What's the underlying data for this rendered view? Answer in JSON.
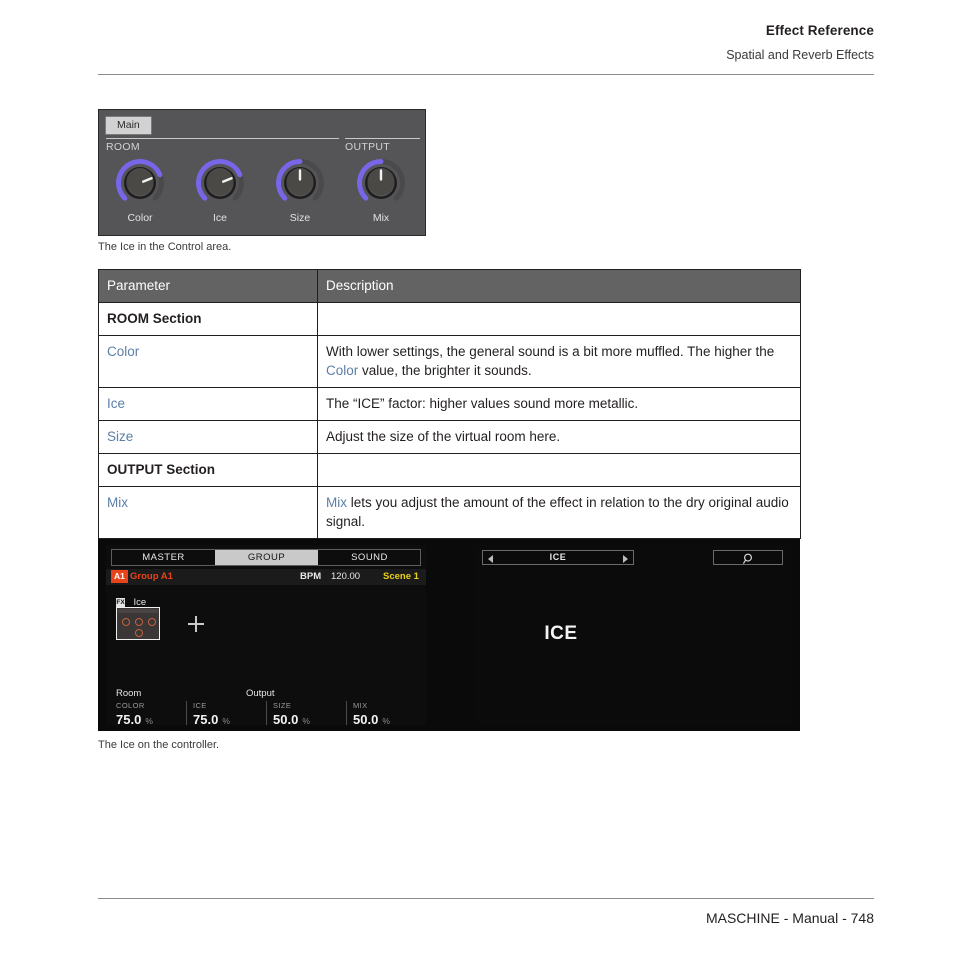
{
  "header": {
    "title": "Effect Reference",
    "subtitle": "Spatial and Reverb Effects"
  },
  "plugin_panel": {
    "tab_label": "Main",
    "sections": {
      "room_label": "ROOM",
      "output_label": "OUTPUT"
    },
    "knobs": [
      {
        "label": "Color",
        "value_pct": 75,
        "arc_color": "#7866e8"
      },
      {
        "label": "Ice",
        "value_pct": 75,
        "arc_color": "#7866e8"
      },
      {
        "label": "Size",
        "value_pct": 50,
        "arc_color": "#7866e8"
      },
      {
        "label": "Mix",
        "value_pct": 50,
        "arc_color": "#7866e8"
      }
    ]
  },
  "caption_control_area": "The Ice in the Control area.",
  "caption_controller": "The Ice on the controller.",
  "table": {
    "headers": [
      "Parameter",
      "Description"
    ],
    "rows": [
      {
        "kind": "section",
        "parameter": "ROOM Section",
        "description": ""
      },
      {
        "kind": "param",
        "parameter": "Color",
        "desc_pre": "With lower settings, the general sound is a bit more muffled. The higher the ",
        "desc_link": "Color",
        "desc_post": " value, the brighter it sounds."
      },
      {
        "kind": "param",
        "parameter": "Ice",
        "desc_pre": "The “ICE” factor: higher values sound more metallic.",
        "desc_link": "",
        "desc_post": ""
      },
      {
        "kind": "param",
        "parameter": "Size",
        "desc_pre": "Adjust the size of the virtual room here.",
        "desc_link": "",
        "desc_post": ""
      },
      {
        "kind": "section",
        "parameter": "OUTPUT Section",
        "description": ""
      },
      {
        "kind": "param-linkfirst",
        "parameter": "Mix",
        "desc_pre": "",
        "desc_link": "Mix",
        "desc_post": " lets you adjust the amount of the effect in relation to the dry original audio signal."
      }
    ]
  },
  "controller": {
    "left_display": {
      "tabs": [
        {
          "label": "MASTER",
          "active": false
        },
        {
          "label": "GROUP",
          "active": true
        },
        {
          "label": "SOUND",
          "active": false
        }
      ],
      "group_badge": "A1",
      "group_name": "Group A1",
      "bpm_label": "BPM",
      "bpm_value": "120.00",
      "scene": "Scene 1",
      "fx_icon_text": "FX",
      "fx_name": "Ice",
      "add_slot_label": "+",
      "section_room": "Room",
      "section_output": "Output",
      "parameters": [
        {
          "name": "COLOR",
          "value": "75.0",
          "unit": "%"
        },
        {
          "name": "ICE",
          "value": "75.0",
          "unit": "%"
        },
        {
          "name": "SIZE",
          "value": "50.0",
          "unit": "%"
        },
        {
          "name": "MIX",
          "value": "50.0",
          "unit": "%"
        }
      ]
    },
    "right_display": {
      "selector_value": "ICE",
      "search_icon": "magnifier-icon",
      "plugin_name": "ICE"
    }
  },
  "footer": {
    "text": "MASCHINE - Manual - 748"
  }
}
